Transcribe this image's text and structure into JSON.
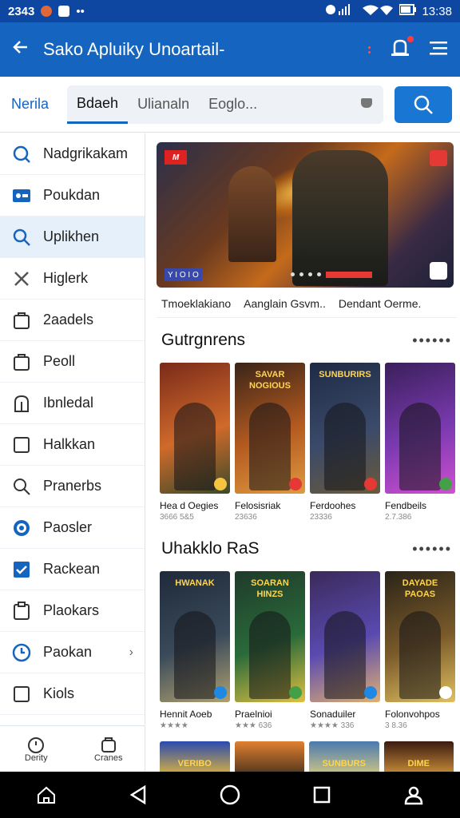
{
  "status": {
    "time": "2343",
    "right_time": "13:38"
  },
  "appbar": {
    "back_icon": "arrow-left-icon",
    "title": "Sako Apluiky Unoartail-"
  },
  "tabs": {
    "first": "Nerila",
    "search_segments": [
      "Bdaeh",
      "Ulianaln",
      "Eoglo..."
    ]
  },
  "sidebar": {
    "items": [
      {
        "label": "Nadgrikakam",
        "icon": "search-circle-icon"
      },
      {
        "label": "Poukdan",
        "icon": "badge-icon"
      },
      {
        "label": "Uplikhen",
        "icon": "search-icon"
      },
      {
        "label": "Higlerk",
        "icon": "close-icon"
      },
      {
        "label": "2aadels",
        "icon": "bag-icon"
      },
      {
        "label": "Peoll",
        "icon": "bag-icon"
      },
      {
        "label": "Ibnledal",
        "icon": "house-icon"
      },
      {
        "label": "Halkkan",
        "icon": "square-icon"
      },
      {
        "label": "Pranerbs",
        "icon": "search-icon"
      },
      {
        "label": "Paosler",
        "icon": "dot-circle-icon"
      },
      {
        "label": "Rackean",
        "icon": "checkbox-icon"
      },
      {
        "label": "Plaokars",
        "icon": "clipboard-icon"
      },
      {
        "label": "Paokan",
        "icon": "clock-icon"
      },
      {
        "label": "Kiols",
        "icon": "square-icon"
      }
    ],
    "bottom_tabs": [
      "Derity",
      "Cranes"
    ]
  },
  "banner": {
    "captions": [
      "Tmoeklakiano",
      "Aanglain Gsvm..",
      "Dendant Oerme."
    ],
    "badge_text": "Y I O I O"
  },
  "sections": [
    {
      "title": "Gutrgnrens",
      "cards": [
        {
          "name": "Hea d Oegies",
          "meta": "3666 5&5",
          "logo": "",
          "colors": [
            "#7a2a1a",
            "#d06a2a",
            "#3a4a2a"
          ],
          "badge": "#f5c542"
        },
        {
          "name": "Felosisriak",
          "meta": "23636",
          "logo": "SAVAR NOGIOUS",
          "colors": [
            "#3a2418",
            "#b45a20",
            "#e09a40"
          ],
          "badge": "#e53935"
        },
        {
          "name": "Ferdoohes",
          "meta": "23336",
          "logo": "SUNBURIRS",
          "colors": [
            "#1f2a44",
            "#3a4a6a",
            "#6a5a3a"
          ],
          "badge": "#e53935"
        },
        {
          "name": "Fendbeils",
          "meta": "2.7.386",
          "logo": "",
          "colors": [
            "#3a1f5a",
            "#7a3ab0",
            "#d050d0"
          ],
          "badge": "#43a047"
        }
      ]
    },
    {
      "title": "Uhakklo RaS",
      "cards": [
        {
          "name": "Hennit Aoeb",
          "meta": "★★★★",
          "logo": "HWANAK",
          "colors": [
            "#1f2a3a",
            "#3a4a5a",
            "#b0a070"
          ],
          "badge": "#1e88e5"
        },
        {
          "name": "Praelnioi",
          "meta": "★★★ 636",
          "logo": "SOARAN HINZS",
          "colors": [
            "#1f3a2a",
            "#2a6a3a",
            "#e0c040"
          ],
          "badge": "#43a047"
        },
        {
          "name": "Sonaduiler",
          "meta": "★★★★ 336",
          "logo": "",
          "colors": [
            "#3a2a5a",
            "#5a4ab0",
            "#e0b070"
          ],
          "badge": "#1e88e5"
        },
        {
          "name": "Folonvohpos",
          "meta": "3 8.36",
          "logo": "DAYADE PAOAS",
          "colors": [
            "#2a2418",
            "#7a5a2a",
            "#e0c060"
          ],
          "badge": "#ffffff"
        }
      ]
    }
  ],
  "peek": [
    {
      "logo": "VERIBO",
      "colors": [
        "#2a4ab0",
        "#f0c030"
      ]
    },
    {
      "logo": "",
      "colors": [
        "#e08030",
        "#3a2a1a"
      ]
    },
    {
      "logo": "SUNBURS",
      "colors": [
        "#4a7ab0",
        "#e0d080"
      ]
    },
    {
      "logo": "DIME",
      "colors": [
        "#3a1a10",
        "#e0a040"
      ]
    }
  ]
}
